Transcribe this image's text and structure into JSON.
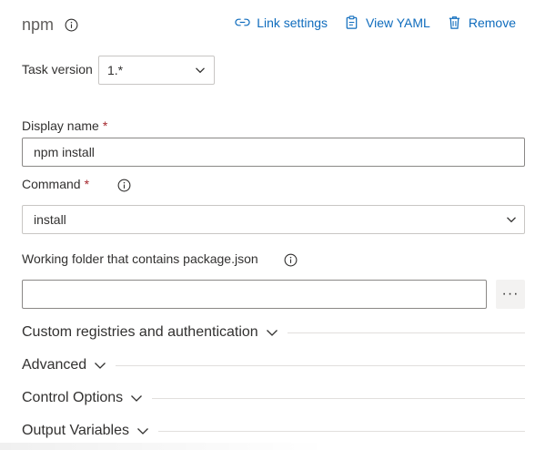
{
  "header": {
    "title": "npm",
    "actions": [
      {
        "label": "Link settings",
        "icon": "link-icon"
      },
      {
        "label": "View YAML",
        "icon": "clipboard-icon"
      },
      {
        "label": "Remove",
        "icon": "trash-icon"
      }
    ]
  },
  "task_version": {
    "label": "Task version",
    "value": "1.*"
  },
  "display_name": {
    "label": "Display name",
    "required_mark": "*",
    "value": "npm install"
  },
  "command": {
    "label": "Command",
    "required_mark": "*",
    "value": "install"
  },
  "working_folder": {
    "label": "Working folder that contains package.json",
    "value": "",
    "more_label": "···"
  },
  "sections": [
    {
      "label": "Custom registries and authentication"
    },
    {
      "label": "Advanced"
    },
    {
      "label": "Control Options"
    },
    {
      "label": "Output Variables"
    }
  ],
  "colors": {
    "accent": "#0f6cbd",
    "required": "#a4262c",
    "text": "#323130"
  }
}
